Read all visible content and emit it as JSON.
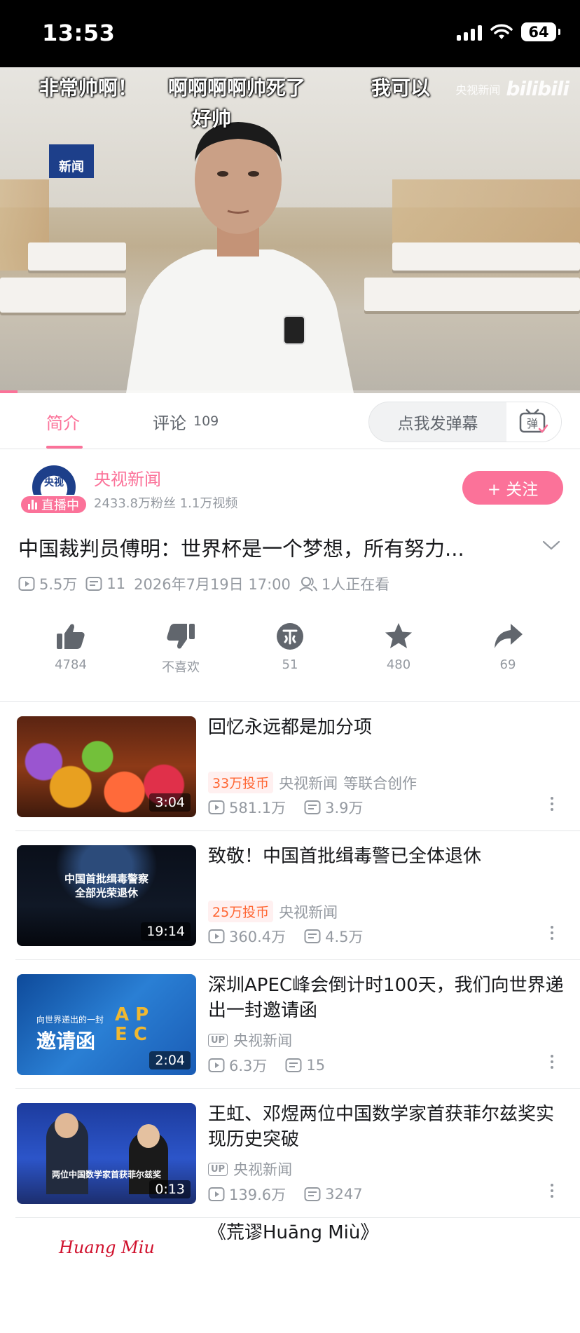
{
  "status_bar": {
    "time": "13:53",
    "battery": "64"
  },
  "video": {
    "danmaku": [
      "非常帅啊！",
      "啊啊啊啊帅死了",
      "我可以",
      "好帅"
    ],
    "channel_logo": "新闻",
    "watermark_channel": "央视新闻",
    "watermark_brand": "bilibili",
    "progress": 0.03
  },
  "tabs": {
    "intro_label": "简介",
    "comments_label": "评论",
    "comments_count": "109",
    "danmu_placeholder": "点我发弹幕",
    "danmu_button_glyph": "弹"
  },
  "uploader": {
    "avatar_text": "央视",
    "live_badge": "直播中",
    "name": "央视新闻",
    "stats": "2433.8万粉丝   1.1万视频",
    "follow_label": "+ 关注"
  },
  "video_info": {
    "title": "中国裁判员傅明：世界杯是一个梦想，所有努力...",
    "views": "5.5万",
    "danmaku_count": "11",
    "date": "2026年7月19日 17:00",
    "watching": "1人正在看"
  },
  "actions": [
    {
      "icon": "thumbs-up-icon",
      "label": "4784"
    },
    {
      "icon": "thumbs-down-icon",
      "label": "不喜欢"
    },
    {
      "icon": "coin-icon",
      "label": "51"
    },
    {
      "icon": "star-icon",
      "label": "480"
    },
    {
      "icon": "share-icon",
      "label": "69"
    }
  ],
  "related": [
    {
      "title": "回忆永远都是加分项",
      "coin_tag": "33万投币",
      "owner": "央视新闻",
      "owner_suffix": "等联合创作",
      "views": "581.1万",
      "danmaku": "3.9万",
      "duration": "3:04"
    },
    {
      "title": "致敬！中国首批缉毒警已全体退休",
      "coin_tag": "25万投币",
      "owner": "央视新闻",
      "views": "360.4万",
      "danmaku": "4.5万",
      "duration": "19:14",
      "thumb_caption": "中国首批缉毒警察\n全部光荣退休"
    },
    {
      "title": "深圳APEC峰会倒计时100天，我们向世界递出一封邀请函",
      "up_tag": "UP",
      "owner": "央视新闻",
      "views": "6.3万",
      "danmaku": "15",
      "duration": "2:04",
      "thumb_caption_small": "向世界递出的一封",
      "thumb_caption_big": "邀请函",
      "thumb_letters": "A P\nE C"
    },
    {
      "title": "王虹、邓煜两位中国数学家首获菲尔兹奖实现历史突破",
      "up_tag": "UP",
      "owner": "央视新闻",
      "views": "139.6万",
      "danmaku": "3247",
      "duration": "0:13",
      "thumb_caption": "两位中国数学家首获菲尔兹奖"
    },
    {
      "title": "《荒谬Huāng Miù》",
      "thumb_caption": "Huang Miu"
    }
  ]
}
